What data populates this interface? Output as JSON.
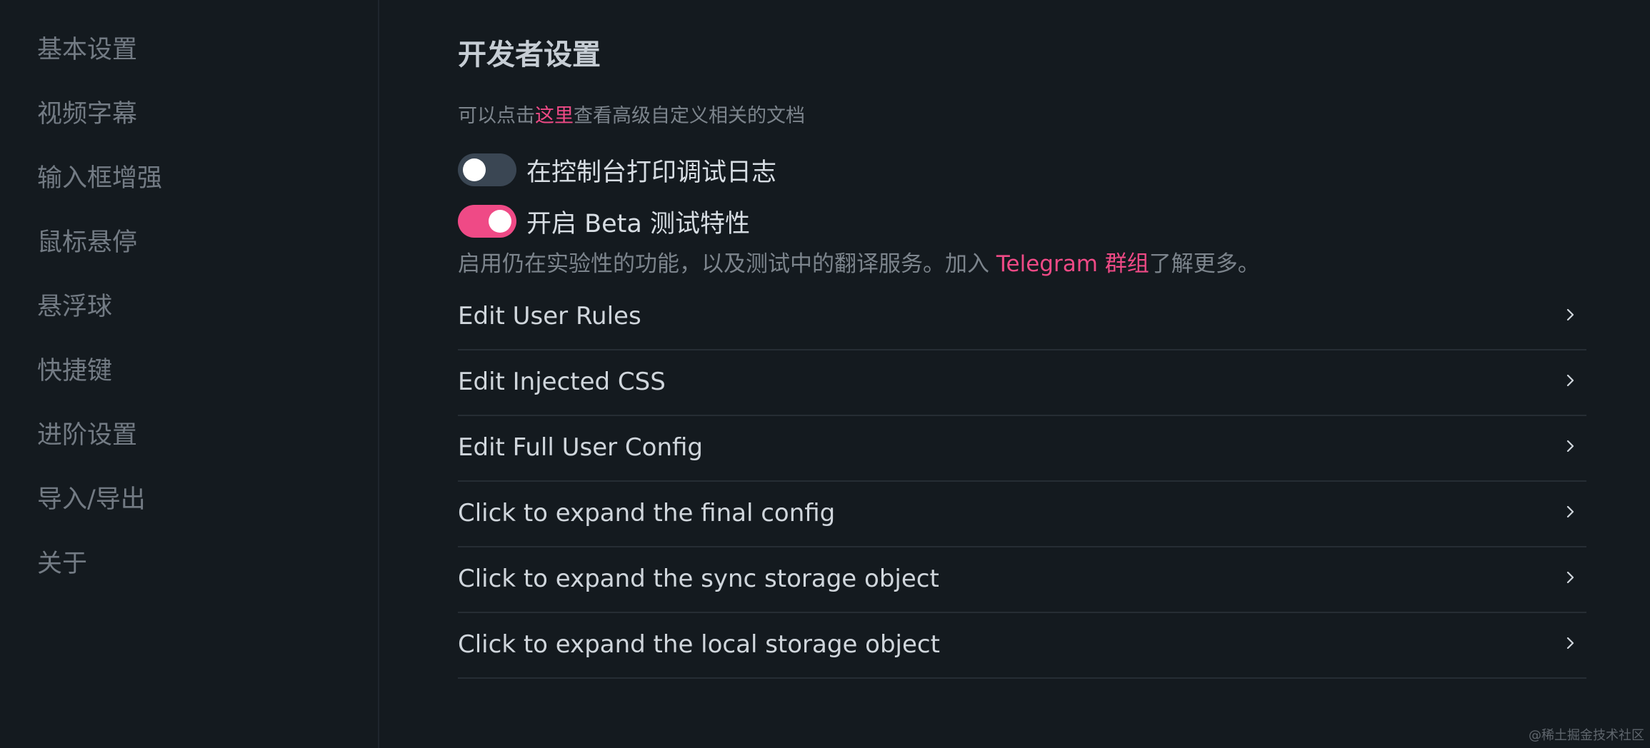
{
  "sidebar": {
    "items": [
      {
        "label": "基本设置"
      },
      {
        "label": "视频字幕"
      },
      {
        "label": "输入框增强"
      },
      {
        "label": "鼠标悬停"
      },
      {
        "label": "悬浮球"
      },
      {
        "label": "快捷键"
      },
      {
        "label": "进阶设置"
      },
      {
        "label": "导入/导出"
      },
      {
        "label": "关于"
      }
    ]
  },
  "main": {
    "title": "开发者设置",
    "doc_note": {
      "before": "可以点击",
      "link": "这里",
      "after": "查看高级自定义相关的文档"
    },
    "toggles": {
      "debug": {
        "label": "在控制台打印调试日志",
        "on": false
      },
      "beta": {
        "label": "开启 Beta 测试特性",
        "on": true
      }
    },
    "beta_desc": {
      "before": "启用仍在实验性的功能，以及测试中的翻译服务。加入 ",
      "link": "Telegram 群组",
      "after": "了解更多。"
    },
    "rows": [
      {
        "label": "Edit User Rules"
      },
      {
        "label": "Edit Injected CSS"
      },
      {
        "label": "Edit Full User Config"
      },
      {
        "label": "Click to expand the final config"
      },
      {
        "label": "Click to expand the sync storage object"
      },
      {
        "label": "Click to expand the local storage object"
      }
    ]
  },
  "colors": {
    "accent": "#ef4a86",
    "background": "#141a1f",
    "toggle_off": "#3a4653"
  },
  "icons": {
    "row_icon": "chevron-right-icon"
  },
  "watermark": "@稀土掘金技术社区"
}
